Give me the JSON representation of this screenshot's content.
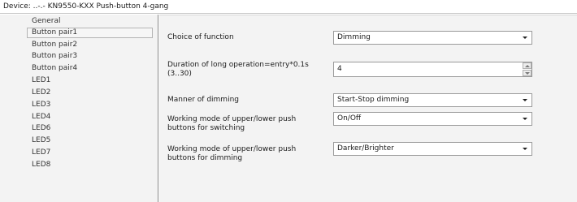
{
  "title": "Device: ..-.- KN9550-KXX Push-button 4-gang",
  "sidebar": {
    "items": [
      {
        "label": "General"
      },
      {
        "label": "Button pair1",
        "selected": true
      },
      {
        "label": "Button pair2"
      },
      {
        "label": "Button pair3"
      },
      {
        "label": "Button pair4"
      },
      {
        "label": "LED1"
      },
      {
        "label": "LED2"
      },
      {
        "label": "LED3"
      },
      {
        "label": "LED4"
      },
      {
        "label": "LED6"
      },
      {
        "label": "LED5"
      },
      {
        "label": "LED7"
      },
      {
        "label": "LED8"
      }
    ]
  },
  "params": {
    "choice_of_function": {
      "label": "Choice of function",
      "value": "Dimming"
    },
    "long_operation": {
      "label_line1": "Duration of long operation=entry*0.1s",
      "label_line2": "(3..30)",
      "value": "4"
    },
    "manner_of_dimming": {
      "label": "Manner of dimming",
      "value": "Start-Stop dimming"
    },
    "working_mode_switching": {
      "label_line1": "Working mode of upper/lower push",
      "label_line2": "buttons for switching",
      "value": "On/Off"
    },
    "working_mode_dimming": {
      "label_line1": "Working mode of upper/lower push",
      "label_line2": "buttons for dimming",
      "value": "Darker/Brighter"
    }
  },
  "icons": {
    "dropdown": "chevron-down-icon",
    "spin_up": "spin-up-icon",
    "spin_down": "spin-down-icon"
  }
}
